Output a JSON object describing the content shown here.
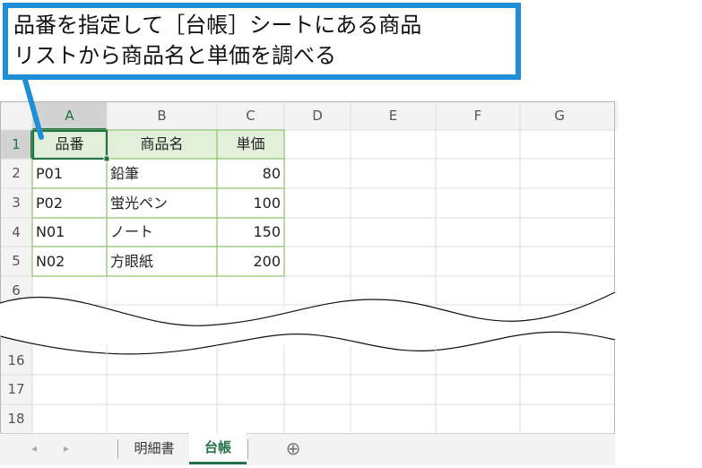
{
  "callout": {
    "line1": "品番を指定して［台帳］シートにある商品",
    "line2": "リストから商品名と単価を調べる"
  },
  "columns": [
    "A",
    "B",
    "C",
    "D",
    "E",
    "F",
    "G"
  ],
  "rows_top": [
    "1",
    "2",
    "3",
    "4",
    "5",
    "6"
  ],
  "rows_bottom": [
    "16",
    "17",
    "18"
  ],
  "table": {
    "headers": [
      "品番",
      "商品名",
      "単価"
    ],
    "rows": [
      [
        "P01",
        "鉛筆",
        "80"
      ],
      [
        "P02",
        "蛍光ペン",
        "100"
      ],
      [
        "N01",
        "ノート",
        "150"
      ],
      [
        "N02",
        "方眼紙",
        "200"
      ]
    ]
  },
  "tabs": {
    "prev": "◂",
    "next": "▸",
    "sheet1": "明細書",
    "sheet2": "台帳",
    "add": "⊕"
  },
  "colors": {
    "accent": "#1e8fd6",
    "header_fill": "#e2efda",
    "table_border": "#8dc26b",
    "active_tab": "#217346"
  }
}
